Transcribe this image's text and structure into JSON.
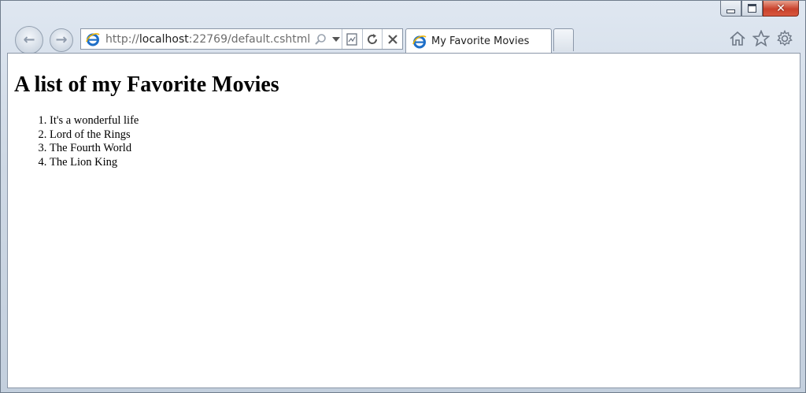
{
  "browser": {
    "url_prefix": "http://",
    "url_host": "localhost",
    "url_rest": ":22769/default.cshtml",
    "tab_title": "My Favorite Movies",
    "accent": "#1e6fc8"
  },
  "icons": {
    "back": "back-arrow-icon",
    "forward": "forward-arrow-icon",
    "search": "search-icon",
    "dropdown": "chevron-down-icon",
    "compat": "compatibility-view-icon",
    "refresh": "refresh-icon",
    "stop": "stop-icon",
    "home": "home-icon",
    "favorites": "star-icon",
    "tools": "gear-icon"
  },
  "page": {
    "heading": "A list of my Favorite Movies",
    "movies": [
      "It's a wonderful life",
      "Lord of the Rings",
      "The Fourth World",
      "The Lion King"
    ]
  }
}
